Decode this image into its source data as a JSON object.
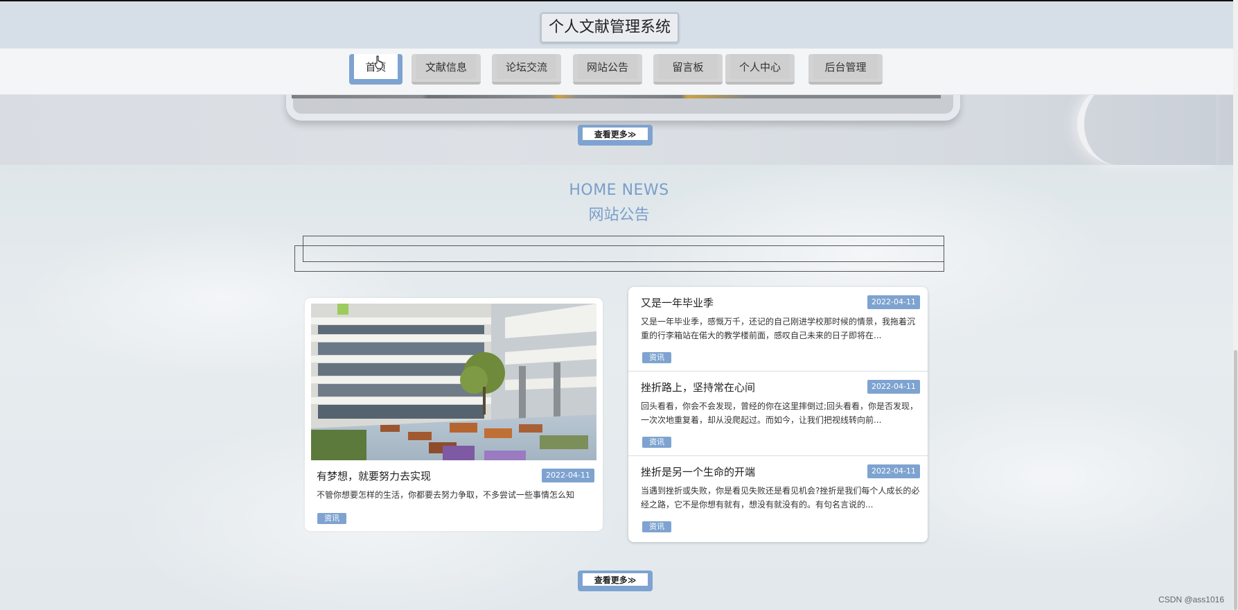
{
  "site": {
    "title": "个人文献管理系统"
  },
  "nav": {
    "items": [
      {
        "label": "首页",
        "active": true
      },
      {
        "label": "文献信息"
      },
      {
        "label": "论坛交流"
      },
      {
        "label": "网站公告"
      },
      {
        "label": "留言板"
      },
      {
        "label": "个人中心"
      },
      {
        "label": "后台管理"
      }
    ]
  },
  "buttons": {
    "more_top": "查看更多≫",
    "more_bottom": "查看更多≫"
  },
  "news_section": {
    "title_en": "HOME NEWS",
    "title_cn": "网站公告",
    "featured": {
      "title": "有梦想，就要努力去实现",
      "date": "2022-04-11",
      "desc": "不管你想要怎样的生活，你都要去努力争取，不多尝试一些事情怎么知",
      "tag": "资讯"
    },
    "items": [
      {
        "title": "又是一年毕业季",
        "date": "2022-04-11",
        "desc": "又是一年毕业季，感慨万千，还记的自己刚进学校那时候的情景，我拖着沉重的行李箱站在偌大的教学楼前面，感叹自己未来的日子即将在...",
        "tag": "资讯"
      },
      {
        "title": "挫折路上，坚持常在心间",
        "date": "2022-04-11",
        "desc": "回头看看，你会不会发现，曾经的你在这里摔倒过;回头看看，你是否发现，一次次地重复着，却从没爬起过。而如今，让我们把视线转向前...",
        "tag": "资讯"
      },
      {
        "title": "挫折是另一个生命的开端",
        "date": "2022-04-11",
        "desc": "当遇到挫折或失败，你是看见失败还是看见机会?挫折是我们每个人成长的必经之路，它不是你想有就有，想没有就没有的。有句名言说的...",
        "tag": "资讯"
      }
    ]
  },
  "watermark": "CSDN @ass1016",
  "colors": {
    "accent": "#7ea3d0",
    "header_bg": "#d6dfe7"
  }
}
